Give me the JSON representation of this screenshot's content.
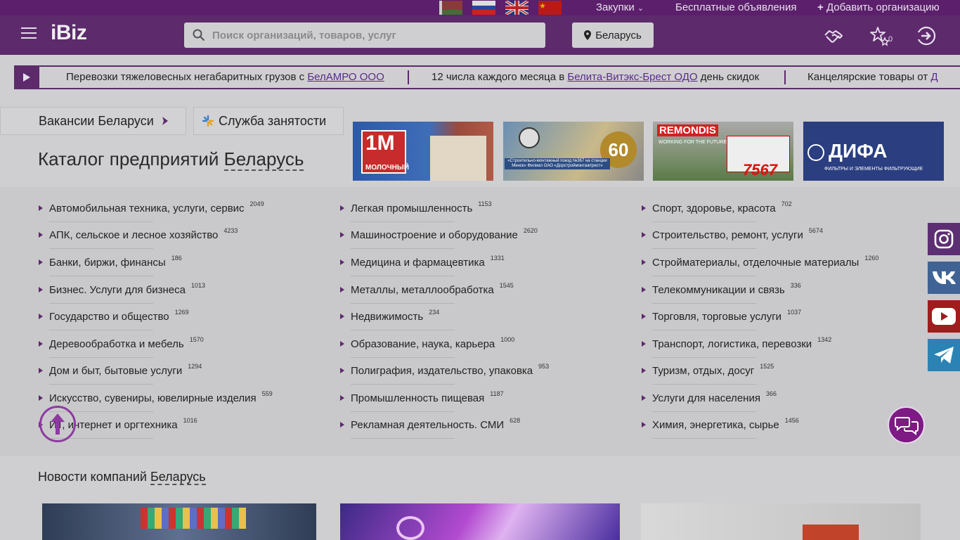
{
  "topbar": {
    "flags": [
      "by-flag",
      "ru-flag",
      "uk-flag",
      "cn-flag"
    ],
    "purchases": "Закупки",
    "free_ads": "Бесплатные объявления",
    "add_org": "Добавить организацию"
  },
  "header": {
    "logo": "iBiz",
    "search_placeholder": "Поиск организаций, товаров, услуг",
    "region": "Беларусь",
    "favorites_count": "0"
  },
  "ticker": {
    "items": [
      {
        "pre": "Перевозки тяжеловесных негабаритных грузов с ",
        "link": "БелАМРО ООО",
        "post": ""
      },
      {
        "pre": "12 числа каждого месяца в ",
        "link": "Белита-Витэкс-Брест ОДО",
        "post": " день скидок"
      },
      {
        "pre": "Канцелярские товары от ",
        "link": "Д",
        "post": ""
      }
    ]
  },
  "subnav": {
    "vacancies": "Вакансии Беларуси",
    "employment": "Служба занятости"
  },
  "catalog": {
    "title_prefix": "Каталог предприятий ",
    "title_city": "Беларусь",
    "columns": [
      [
        {
          "label": "Автомобильная техника, услуги, сервис",
          "count": "2049"
        },
        {
          "label": "АПК, сельское и лесное хозяйство",
          "count": "4233"
        },
        {
          "label": "Банки, биржи, финансы",
          "count": "186"
        },
        {
          "label": "Бизнес. Услуги для бизнеса",
          "count": "1013"
        },
        {
          "label": "Государство и общество",
          "count": "1269"
        },
        {
          "label": "Деревообработка и мебель",
          "count": "1570"
        },
        {
          "label": "Дом и быт, бытовые услуги",
          "count": "1294"
        },
        {
          "label": "Искусство, сувениры, ювелирные изделия",
          "count": "559"
        },
        {
          "label": "ИТ, интернет и оргтехника",
          "count": "1016"
        }
      ],
      [
        {
          "label": "Легкая промышленность",
          "count": "1153"
        },
        {
          "label": "Машиностроение и оборудование",
          "count": "2620"
        },
        {
          "label": "Медицина и фармацевтика",
          "count": "1331"
        },
        {
          "label": "Металлы, металлообработка",
          "count": "1545"
        },
        {
          "label": "Недвижимость",
          "count": "234"
        },
        {
          "label": "Образование, наука, карьера",
          "count": "1000"
        },
        {
          "label": "Полиграфия, издательство, упаковка",
          "count": "953"
        },
        {
          "label": "Промышленность пищевая",
          "count": "1187"
        },
        {
          "label": "Рекламная деятельность. СМИ",
          "count": "628"
        }
      ],
      [
        {
          "label": "Спорт, здоровье, красота",
          "count": "702"
        },
        {
          "label": "Строительство, ремонт, услуги",
          "count": "5674"
        },
        {
          "label": "Стройматериалы, отделочные материалы",
          "count": "1260"
        },
        {
          "label": "Телекоммуникации и связь",
          "count": "336"
        },
        {
          "label": "Торговля, торговые услуги",
          "count": "1037"
        },
        {
          "label": "Транспорт, логистика, перевозки",
          "count": "1342"
        },
        {
          "label": "Туризм, отдых, досуг",
          "count": "1525"
        },
        {
          "label": "Услуги для населения",
          "count": "366"
        },
        {
          "label": "Химия, энергетика, сырье",
          "count": "1456"
        }
      ]
    ]
  },
  "banners": [
    {
      "name": "banner-molochny",
      "text1": "1M",
      "text2": "МОЛОЧНЫЙ"
    },
    {
      "name": "banner-smp367",
      "text1": "60",
      "text2": "«Строительно-монтажный поезд №367 на станции Минск» Филиал ОАО «Дорстроймонтажтрест»"
    },
    {
      "name": "banner-remondis",
      "text1": "REMONDIS",
      "text2": "WORKING FOR THE FUTURE",
      "text3": "7567"
    },
    {
      "name": "banner-difa",
      "text1": "ДИФА",
      "text2": "ФИЛЬТРЫ И ЭЛЕМЕНТЫ ФИЛЬТРУЮЩИЕ"
    }
  ],
  "news": {
    "title_prefix": "Новости компаний ",
    "title_city": "Беларусь"
  },
  "social": [
    "instagram-icon",
    "vk-icon",
    "youtube-icon",
    "telegram-icon"
  ],
  "colors": {
    "brand": "#5d2a6c",
    "accent": "#7d1a83",
    "link": "#5a2a8a"
  }
}
